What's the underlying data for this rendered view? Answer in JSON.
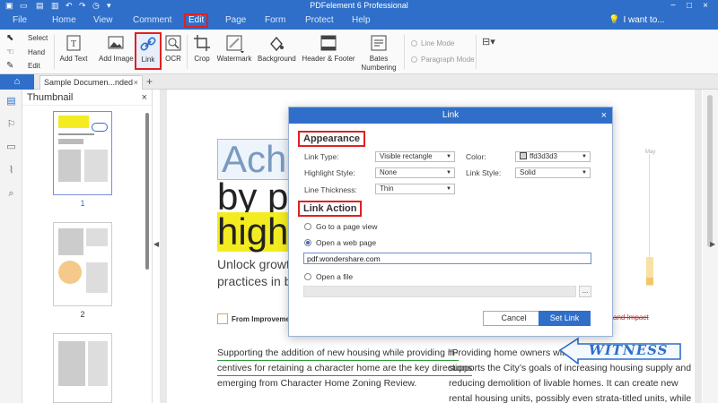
{
  "app": {
    "title": "PDFelement 6 Professional",
    "window_controls": [
      "−",
      "□",
      "×"
    ]
  },
  "menubar": {
    "items": [
      "File",
      "Home",
      "View",
      "Comment",
      "Edit",
      "Page",
      "Form",
      "Protect",
      "Help"
    ],
    "active": "Edit",
    "search_label": "I want to..."
  },
  "ribbon": {
    "select_items": [
      "Select",
      "Hand",
      "Edit"
    ],
    "tools": [
      "Add Text",
      "Add Image",
      "Link",
      "OCR",
      "Crop",
      "Watermark",
      "Background",
      "Header & Footer",
      "Bates\nNumbering"
    ],
    "bates_line1": "Bates",
    "bates_line2": "Numbering",
    "selected_tool": "Link",
    "modes": [
      "Line Mode",
      "Paragraph Mode"
    ]
  },
  "tabs": {
    "doc_tab": "Sample Documen...nded",
    "close": "×",
    "add": "+"
  },
  "thumbnail_panel": {
    "title": "Thumbnail",
    "close": "×",
    "pages": [
      "1",
      "2"
    ],
    "current_page": "1"
  },
  "document": {
    "headline": [
      "Achie",
      "by pu",
      "highes"
    ],
    "subtitle": [
      "Unlock growth for",
      "practices in busin"
    ],
    "from_text": "From Improvement to P",
    "impact_text": "and Impact",
    "left_para": [
      "Supporting the addition of new housing while providing in-",
      "centives for retaining a character home are the key directions",
      "emerging from Character Home Zoning Review."
    ],
    "right_para": [
      "“Providing home owners with these types of incentives",
      "supports the City’s goals of increasing housing supply and",
      "reducing demolition of livable homes.  It can create new",
      "rental housing units, possibly even strata-titled units, while"
    ],
    "chart_label": "May"
  },
  "stamp": {
    "text": "WITNESS"
  },
  "dialog": {
    "title": "Link",
    "close": "×",
    "appearance_heading": "Appearance",
    "link_type_label": "Link Type:",
    "link_type_value": "Visible rectangle",
    "color_label": "Color:",
    "color_value": "ffd3d3d3",
    "color_hex": "#d3d3d3",
    "highlight_label": "Highlight Style:",
    "highlight_value": "None",
    "link_style_label": "Link Style:",
    "link_style_value": "Solid",
    "thickness_label": "Line Thickness:",
    "thickness_value": "Thin",
    "action_heading": "Link Action",
    "opt_page_view": "Go to a page view",
    "opt_web_page": "Open a web page",
    "url_value": "pdf.wondershare.com",
    "opt_file": "Open a file",
    "browse": "...",
    "cancel": "Cancel",
    "set_link": "Set Link"
  },
  "colors": {
    "accent": "#2f6fc9",
    "highlight_red": "#e02020",
    "yellow_highlight": "#f3ec20"
  }
}
